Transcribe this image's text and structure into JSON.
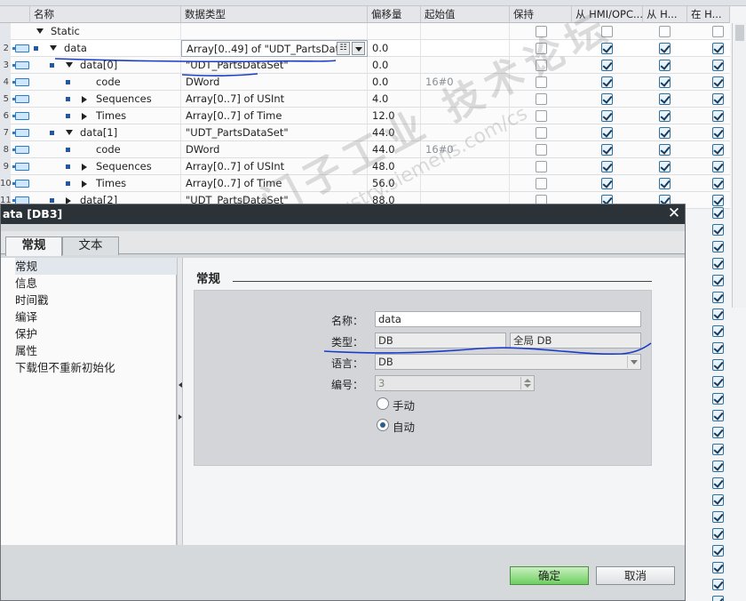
{
  "table": {
    "headers": {
      "name": "名称",
      "datatype": "数据类型",
      "offset": "偏移量",
      "start": "起始值",
      "retain": "保持",
      "hmi_opc": "从 HMI/OPC...",
      "h1": "从 H...",
      "h2": "在 H..."
    },
    "rows": [
      {
        "num": "",
        "name": "Static",
        "type": "",
        "offset": "",
        "start": "",
        "retain": false,
        "c1": false,
        "c2": false,
        "c3": false
      },
      {
        "num": "2",
        "name": "data",
        "type": "Array[0..49] of \"UDT_PartsDat...",
        "offset": "0.0",
        "start": "",
        "retain": false,
        "c1": true,
        "c2": true,
        "c3": true
      },
      {
        "num": "3",
        "name": "data[0]",
        "type": "\"UDT_PartsDataSet\"",
        "offset": "0.0",
        "start": "",
        "retain": false,
        "c1": true,
        "c2": true,
        "c3": true
      },
      {
        "num": "4",
        "name": "code",
        "type": "DWord",
        "offset": "0.0",
        "start": "16#0",
        "retain": false,
        "c1": true,
        "c2": true,
        "c3": true
      },
      {
        "num": "5",
        "name": "Sequences",
        "type": "Array[0..7] of USInt",
        "offset": "4.0",
        "start": "",
        "retain": false,
        "c1": true,
        "c2": true,
        "c3": true
      },
      {
        "num": "6",
        "name": "Times",
        "type": "Array[0..7] of Time",
        "offset": "12.0",
        "start": "",
        "retain": false,
        "c1": true,
        "c2": true,
        "c3": true
      },
      {
        "num": "7",
        "name": "data[1]",
        "type": "\"UDT_PartsDataSet\"",
        "offset": "44.0",
        "start": "",
        "retain": false,
        "c1": true,
        "c2": true,
        "c3": true
      },
      {
        "num": "8",
        "name": "code",
        "type": "DWord",
        "offset": "44.0",
        "start": "16#0",
        "retain": false,
        "c1": true,
        "c2": true,
        "c3": true
      },
      {
        "num": "9",
        "name": "Sequences",
        "type": "Array[0..7] of USInt",
        "offset": "48.0",
        "start": "",
        "retain": false,
        "c1": true,
        "c2": true,
        "c3": true
      },
      {
        "num": "10",
        "name": "Times",
        "type": "Array[0..7] of Time",
        "offset": "56.0",
        "start": "",
        "retain": false,
        "c1": true,
        "c2": true,
        "c3": true
      },
      {
        "num": "11",
        "name": "data[2]",
        "type": "\"UDT_PartsDataSet\"",
        "offset": "88.0",
        "start": "",
        "retain": false,
        "c1": true,
        "c2": true,
        "c3": true
      }
    ]
  },
  "dialog": {
    "title": "ata [DB3]",
    "tabs": [
      "常规",
      "文本"
    ],
    "nav": [
      "常规",
      "信息",
      "时间戳",
      "编译",
      "保护",
      "属性",
      "下载但不重新初始化"
    ],
    "section_title": "常规",
    "fields": {
      "name_label": "名称：",
      "name_value": "data",
      "type_label": "类型：",
      "type_value": "DB",
      "type_extra": "全局 DB",
      "lang_label": "语言：",
      "lang_value": "DB",
      "num_label": "编号：",
      "num_value": "3"
    },
    "radios": {
      "manual": "手动",
      "auto": "自动",
      "selected": "auto"
    },
    "buttons": {
      "ok": "确定",
      "cancel": "取消"
    }
  },
  "watermark": {
    "line1": "西门子工业 技术论坛",
    "line2": "support.industry.siemens.com/cs"
  },
  "colors": {
    "accent": "#2456a6",
    "ok_button": "#6fcf61",
    "annotation": "#1a3cc8"
  }
}
